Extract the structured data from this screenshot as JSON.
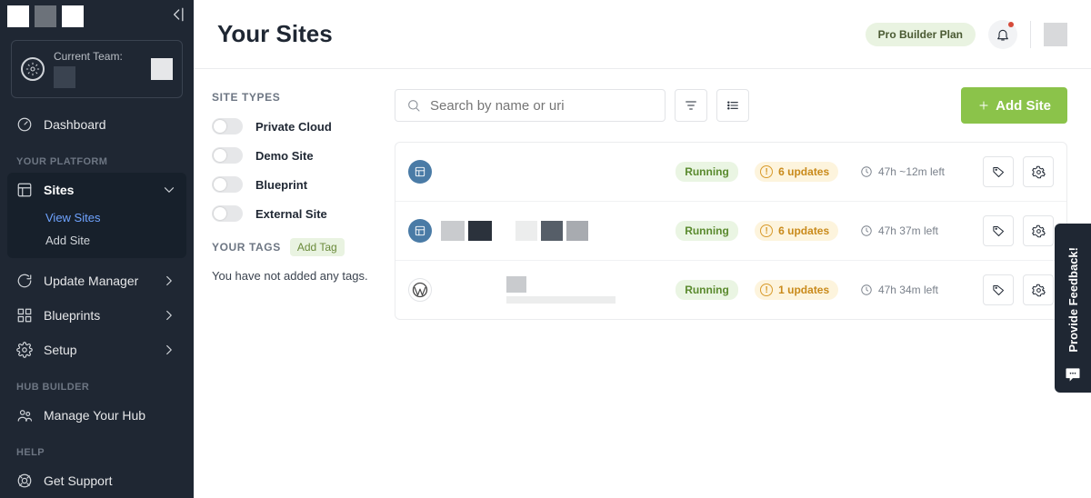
{
  "header": {
    "title": "Your Sites",
    "plan_badge": "Pro Builder Plan"
  },
  "sidebar": {
    "team_label": "Current Team:",
    "dashboard": "Dashboard",
    "sections": {
      "platform_heading": "YOUR PLATFORM",
      "hub_heading": "HUB BUILDER",
      "help_heading": "HELP"
    },
    "sites_label": "Sites",
    "sites_sub": {
      "view": "View Sites",
      "add": "Add Site"
    },
    "update_manager": "Update Manager",
    "blueprints": "Blueprints",
    "setup": "Setup",
    "manage_hub": "Manage Your Hub",
    "get_support": "Get Support"
  },
  "filters": {
    "types_heading": "SITE TYPES",
    "private_cloud": "Private Cloud",
    "demo_site": "Demo Site",
    "blueprint": "Blueprint",
    "external_site": "External Site",
    "tags_heading": "YOUR TAGS",
    "add_tag": "Add Tag",
    "empty_tags": "You have not added any tags."
  },
  "toolbar": {
    "search_placeholder": "Search by name or uri",
    "add_site": "Add Site"
  },
  "sites": [
    {
      "icon": "grid",
      "status": "Running",
      "updates": "6 updates",
      "backup": "47h ~12m left"
    },
    {
      "icon": "grid",
      "status": "Running",
      "updates": "6 updates",
      "backup": "47h 37m left"
    },
    {
      "icon": "wp",
      "status": "Running",
      "updates": "1 updates",
      "backup": "47h 34m left"
    }
  ],
  "feedback_label": "Provide Feedback!"
}
